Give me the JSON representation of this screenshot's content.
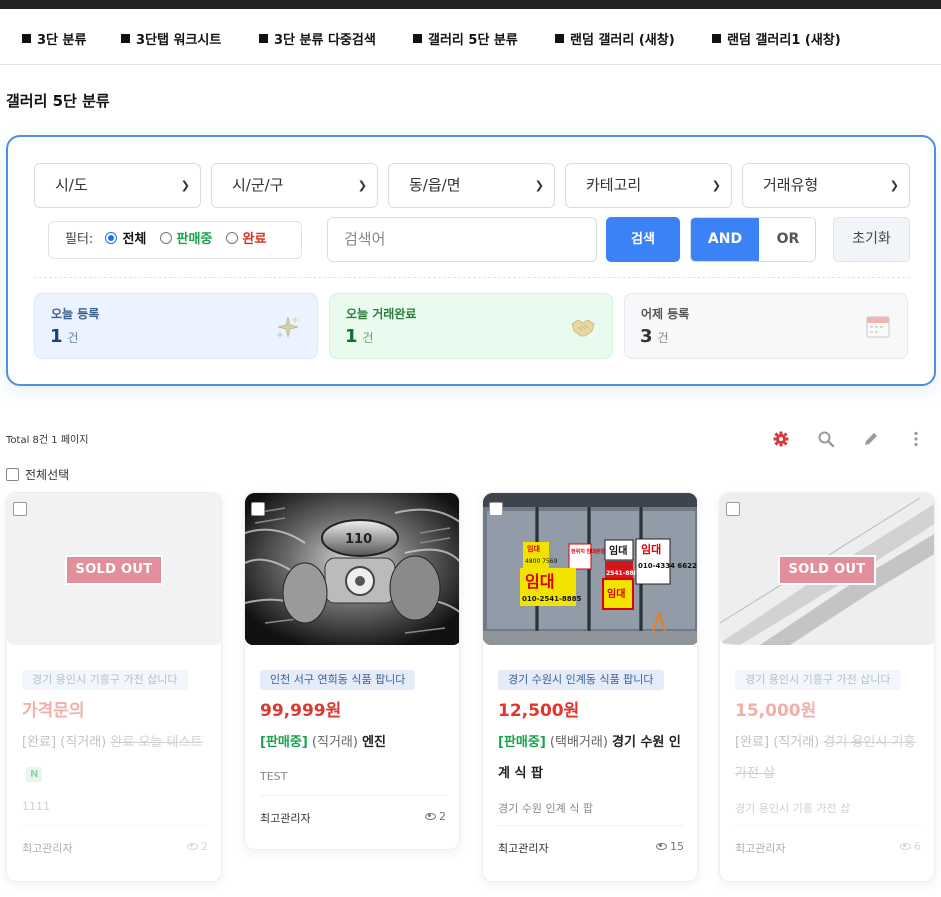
{
  "menu": [
    {
      "label": "3단 분류"
    },
    {
      "label": "3단탭 워크시트"
    },
    {
      "label": "3단 분류 다중검색"
    },
    {
      "label": "갤러리 5단 분류"
    },
    {
      "label": "랜덤 갤러리 (새창)"
    },
    {
      "label": "랜덤 갤러리1 (새창)"
    }
  ],
  "page_title": "갤러리 5단 분류",
  "search": {
    "selects": [
      "시/도",
      "시/군/구",
      "동/읍/면",
      "카테고리",
      "거래유형"
    ],
    "filter_label": "필터:",
    "filter_options": [
      "전체",
      "판매중",
      "완료"
    ],
    "filter_selected": "전체",
    "keyword_placeholder": "검색어",
    "search_button": "검색",
    "and_label": "AND",
    "or_label": "OR",
    "reset_button": "초기화"
  },
  "stats": [
    {
      "title": "오늘 등록",
      "count": "1",
      "unit": "건",
      "icon": "sparkles-icon"
    },
    {
      "title": "오늘 거래완료",
      "count": "1",
      "unit": "건",
      "icon": "handshake-icon"
    },
    {
      "title": "어제 등록",
      "count": "3",
      "unit": "건",
      "icon": "calendar-icon"
    }
  ],
  "list": {
    "total_text": "Total 8건 1 페이지",
    "select_all": "전체선택",
    "tools": [
      "gear-icon",
      "search-icon",
      "pencil-icon",
      "more-vertical-icon"
    ]
  },
  "cards": [
    {
      "sold_out": "SOLD OUT",
      "tag": "경기 용인시 기흥구 가전 삽니다",
      "price": "가격문의",
      "status": "[완료]",
      "mode": "(직거래)",
      "title": "완료 오늘 테스트",
      "new_badge": "N",
      "desc": "1111",
      "author": "최고관리자",
      "views": "2"
    },
    {
      "tag": "인천 서구 연희동 식품 팝니다",
      "price": "99,999원",
      "status": "[판매중]",
      "mode": "(직거래)",
      "title": "엔진",
      "desc": "TEST",
      "author": "최고관리자",
      "views": "2"
    },
    {
      "tag": "경기 수원시 인계동 식품 팝니다",
      "price": "12,500원",
      "status": "[판매중]",
      "mode": "(택배거래)",
      "title": "경기 수원 인계 식 팝",
      "desc": "경기 수원 인계 식 팝",
      "author": "최고관리자",
      "views": "15",
      "signs": {
        "s1": "임대",
        "s2": "4800 7569",
        "s3": "현위치 임대분양",
        "s4": "임대",
        "s5": "2541-8885",
        "s6": "임대",
        "s7": "010-4334 6622",
        "s8": "임대",
        "s9": "010-2541-8885",
        "s10": "임대"
      }
    },
    {
      "sold_out": "SOLD OUT",
      "tag": "경기 용인시 기흥구 가전 삽니다",
      "price": "15,000원",
      "status": "[완료]",
      "mode": "(직거래)",
      "title": "경기 용인시 기흥 가전 삽",
      "desc": "경기 용인시 기흥 가전 삽",
      "author": "최고관리자",
      "views": "6"
    }
  ],
  "colors": {
    "accent": "#3b82f6",
    "box_border": "#4d8fe0",
    "price": "#e0362c",
    "sale": "#19a34a",
    "done": "#d93025",
    "soldout": "#e38f9b"
  }
}
